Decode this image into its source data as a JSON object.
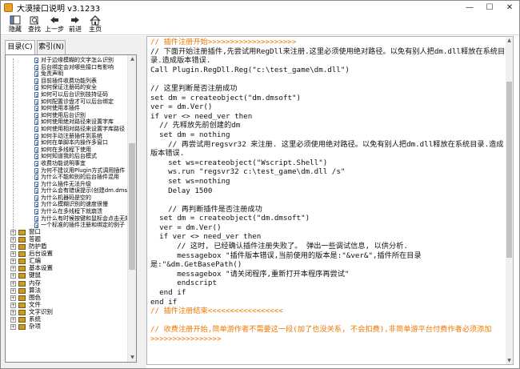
{
  "window": {
    "title": "大漠接口说明 v3.1233",
    "controls": {
      "minimize": "—",
      "maximize": "☐",
      "close": "✕"
    }
  },
  "toolbar": {
    "hide": "隐藏",
    "find": "查找",
    "back": "上一步",
    "forward": "前进",
    "home": "主页"
  },
  "tabs": {
    "contents": "目录(C)",
    "index": "索引(N)"
  },
  "tree": {
    "topics": [
      "对于边缘模糊的文字怎么识别",
      "后台绑定会对哪些接口有影响",
      "免责声明",
      "目前插件收费功能列表",
      "如何保证注册码的安全",
      "如何可以后台识别技持证码",
      "如何配置诊盘才可以后台绑定",
      "如何使用本插件",
      "如何使用后台识别",
      "如何使用绝对路径来设置字库",
      "如何使用相对路径来设置字库路径",
      "如何手动注册插件到系统",
      "如何在单脚本内操作多窗口",
      "如何在多线程下使用",
      "如何知道我的后台模式",
      "收费功能说明事宜",
      "为何不建议用Plugin方式调用插件",
      "为什么不能和别的后台插件混用",
      "为什么插件无法升级",
      "为什么会有错误提示(创建dm.dmsoft对象失败)",
      "为什么机器码是空的",
      "为什么模糊识别的速度很慢",
      "为什么在多线程下就崩溃",
      "为什么有时候按键和鼠标会点击无效",
      "一个标准的插件注册和绑定的例子"
    ],
    "folders": [
      "窗口",
      "答题",
      "防护盾",
      "后台设置",
      "汇编",
      "基本设置",
      "键鼠",
      "内存",
      "算法",
      "图色",
      "文件",
      "文字识别",
      "系统",
      "杂项"
    ],
    "expand_glyph": "+"
  },
  "code": {
    "lines": [
      {
        "t": "c",
        "s": "// 插件注册开始>>>>>>>>>>>>>>>>>>>>"
      },
      {
        "t": "w",
        "s": "// 下面开始注册插件,先尝试用RegDll来注册.这里必须使用绝对路径。以免有别人把dm.dll释放在系统目录.造成版本错误."
      },
      {
        "t": "n",
        "s": "Call Plugin.RegDll.Reg(\"c:\\test_game\\dm.dll\")"
      },
      {
        "t": "n",
        "s": ""
      },
      {
        "t": "n",
        "s": "// 这里判断是否注册成功"
      },
      {
        "t": "n",
        "s": "set dm = createobject(\"dm.dmsoft\")"
      },
      {
        "t": "n",
        "s": "ver = dm.Ver()"
      },
      {
        "t": "n",
        "s": "if ver <> need_ver then"
      },
      {
        "t": "n",
        "s": "  // 先释放先前创建的dm"
      },
      {
        "t": "n",
        "s": "  set dm = nothing"
      },
      {
        "t": "w",
        "s": "    // 再尝试用regsvr32 来注册. 这里必须使用绝对路径。以免有别人把dm.dll释放在系统目录.造成版本错误."
      },
      {
        "t": "n",
        "s": "    set ws=createobject(\"Wscript.Shell\")"
      },
      {
        "t": "n",
        "s": "    ws.run \"regsvr32 c:\\test_game\\dm.dll /s\""
      },
      {
        "t": "n",
        "s": "    set ws=nothing"
      },
      {
        "t": "n",
        "s": "    Delay 1500"
      },
      {
        "t": "n",
        "s": ""
      },
      {
        "t": "n",
        "s": "    // 再判断插件是否注册成功"
      },
      {
        "t": "n",
        "s": "  set dm = createobject(\"dm.dmsoft\")"
      },
      {
        "t": "n",
        "s": "  ver = dm.Ver()"
      },
      {
        "t": "n",
        "s": "  if ver <> need_ver then"
      },
      {
        "t": "n",
        "s": "      // 这时, 已经确认插件注册失败了。 弹出一些调试信息, 以供分析."
      },
      {
        "t": "w",
        "s": "      messagebox \"插件版本错误,当前使用的版本是:\"&ver&\",插件所在目录是:\"&dm.GetBasePath()"
      },
      {
        "t": "n",
        "s": "      messagebox \"请关闭程序,重新打开本程序再尝试\""
      },
      {
        "t": "n",
        "s": "      endscript"
      },
      {
        "t": "n",
        "s": "  end if"
      },
      {
        "t": "n",
        "s": "end if"
      },
      {
        "t": "c",
        "s": "// 插件注册结束<<<<<<<<<<<<<<<<<"
      },
      {
        "t": "n",
        "s": ""
      },
      {
        "t": "cw",
        "s": "// 收费注册开始,简单游作者不需要这一段(加了也没关系, 不会扣费),非简单游平台付费作者必须添加>>>>>>>>>>>>>>>>"
      }
    ]
  },
  "colors": {
    "comment": "#f07800",
    "tab_border": "#adadad",
    "pane_bg": "#f0f0f0"
  },
  "icons": [
    "app-icon",
    "hide-icon",
    "find-icon",
    "back-icon",
    "forward-icon",
    "home-icon",
    "book-icon",
    "document-icon"
  ]
}
